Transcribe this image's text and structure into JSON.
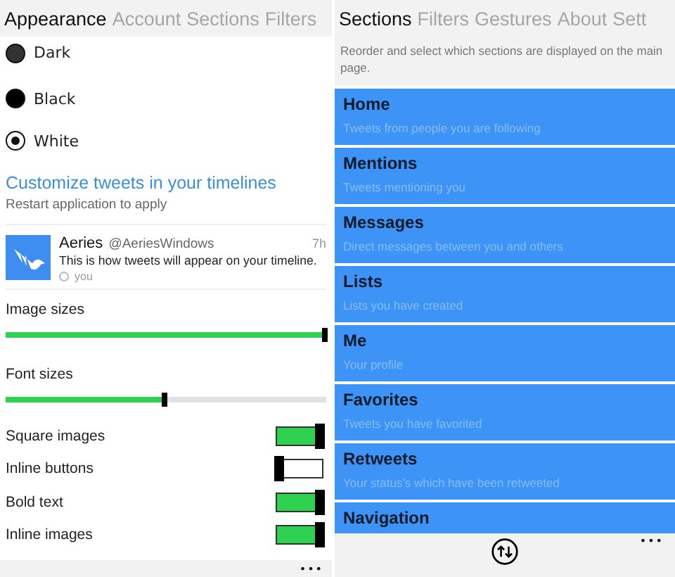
{
  "left": {
    "tabs": [
      {
        "label": "Appearance",
        "selected": true
      },
      {
        "label": "Account",
        "selected": false
      },
      {
        "label": "Sections",
        "selected": false
      },
      {
        "label": "Filters",
        "selected": false
      }
    ],
    "themes": [
      {
        "label": "Dark",
        "color": "#333333",
        "selected": false
      },
      {
        "label": "Black",
        "color": "#000000",
        "selected": false
      },
      {
        "label": "White",
        "color": "#ffffff",
        "selected": true
      }
    ],
    "customize": {
      "title": "Customize tweets in your timelines",
      "note": "Restart application to apply"
    },
    "tweet": {
      "name": "Aeries",
      "handle": "@AeriesWindows",
      "time": "7h",
      "text": "This is how tweets will appear on your timeline.",
      "source": "you"
    },
    "sliders": [
      {
        "label": "Image sizes",
        "level": 1.0
      },
      {
        "label": "Font sizes",
        "level": 0.5
      }
    ],
    "toggles": [
      {
        "label": "Square images",
        "on": true
      },
      {
        "label": "Inline buttons",
        "on": false
      },
      {
        "label": "Bold text",
        "on": true
      },
      {
        "label": "Inline images",
        "on": true
      }
    ],
    "more": "•••"
  },
  "right": {
    "tabs": [
      {
        "label": "Sections",
        "selected": true
      },
      {
        "label": "Filters",
        "selected": false
      },
      {
        "label": "Gestures",
        "selected": false
      },
      {
        "label": "About",
        "selected": false
      },
      {
        "label": "Sett",
        "selected": false
      }
    ],
    "description": "Reorder and select which sections are displayed on the main page.",
    "sections": [
      {
        "title": "Home",
        "subtitle": "Tweets from people you are following"
      },
      {
        "title": "Mentions",
        "subtitle": "Tweets mentioning you"
      },
      {
        "title": "Messages",
        "subtitle": "Direct messages between you and others"
      },
      {
        "title": "Lists",
        "subtitle": "Lists you have created"
      },
      {
        "title": "Me",
        "subtitle": "Your profile"
      },
      {
        "title": "Favorites",
        "subtitle": "Tweets you have favorited"
      },
      {
        "title": "Retweets",
        "subtitle": "Your status's which have been retweeted"
      },
      {
        "title": "Navigation"
      }
    ],
    "more": "•••"
  }
}
